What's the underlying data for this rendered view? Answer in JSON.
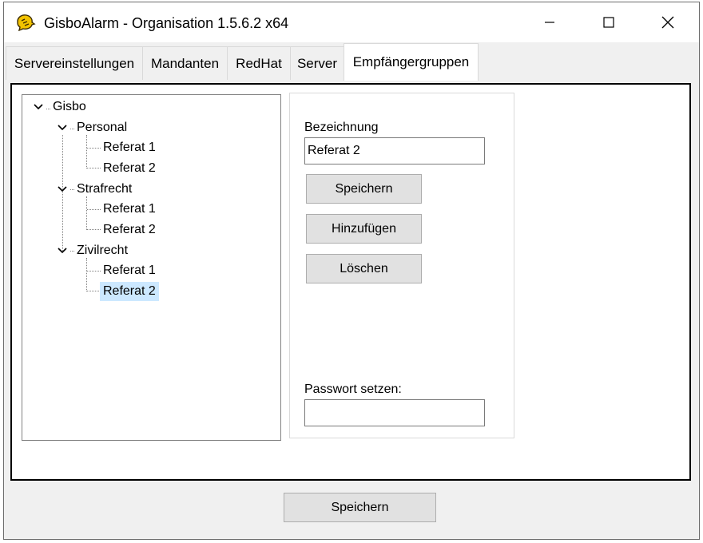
{
  "window": {
    "title": "GisboAlarm - Organisation 1.5.6.2 x64"
  },
  "tabs": [
    {
      "label": "Servereinstellungen",
      "active": false
    },
    {
      "label": "Mandanten",
      "active": false
    },
    {
      "label": "RedHat",
      "active": false
    },
    {
      "label": "Server",
      "active": false
    },
    {
      "label": "Empfängergruppen",
      "active": true
    }
  ],
  "tree": {
    "root": "Gisbo",
    "groups": [
      {
        "label": "Personal",
        "children": [
          "Referat 1",
          "Referat 2"
        ]
      },
      {
        "label": "Strafrecht",
        "children": [
          "Referat 1",
          "Referat 2"
        ]
      },
      {
        "label": "Zivilrecht",
        "children": [
          "Referat 1",
          "Referat 2"
        ]
      }
    ],
    "selected": "Zivilrecht / Referat 2"
  },
  "form": {
    "bezeichnung_label": "Bezeichnung",
    "bezeichnung_value": "Referat 2",
    "save_label": "Speichern",
    "add_label": "Hinzufügen",
    "delete_label": "Löschen",
    "password_label": "Passwort setzen:",
    "password_value": ""
  },
  "footer": {
    "save_label": "Speichern"
  },
  "colors": {
    "selection": "#cce8ff",
    "button_face": "#e1e1e1",
    "window_bg": "#f0f0f0"
  }
}
